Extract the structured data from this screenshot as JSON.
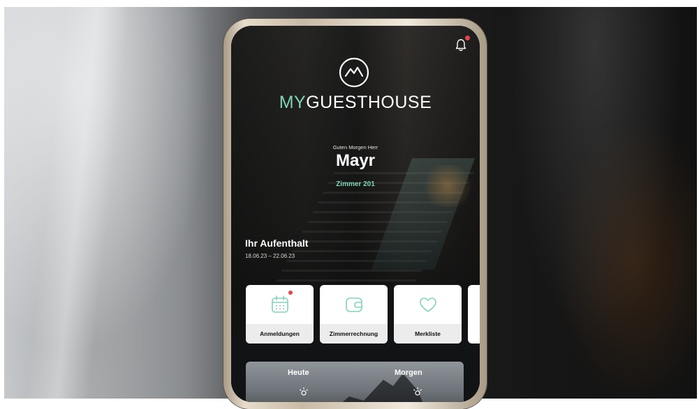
{
  "app": {
    "brand_prefix": "MY",
    "brand_suffix": "GUESTHOUSE"
  },
  "guest": {
    "greeting": "Guten Morgen Herr",
    "name": "Mayr",
    "room": "Zimmer 201"
  },
  "stay": {
    "title": "Ihr Aufenthalt",
    "dates": "18.06.23 – 22.06.23"
  },
  "cards": [
    {
      "label": "Anmeldungen",
      "icon": "calendar-icon",
      "has_badge": true
    },
    {
      "label": "Zimmerrechnung",
      "icon": "wallet-icon",
      "has_badge": false
    },
    {
      "label": "Merkliste",
      "icon": "heart-icon",
      "has_badge": false
    }
  ],
  "weather": {
    "today": "Heute",
    "tomorrow": "Morgen"
  },
  "colors": {
    "accent": "#7fd6b7",
    "badge": "#e3444a",
    "card_band": "#ececec"
  }
}
